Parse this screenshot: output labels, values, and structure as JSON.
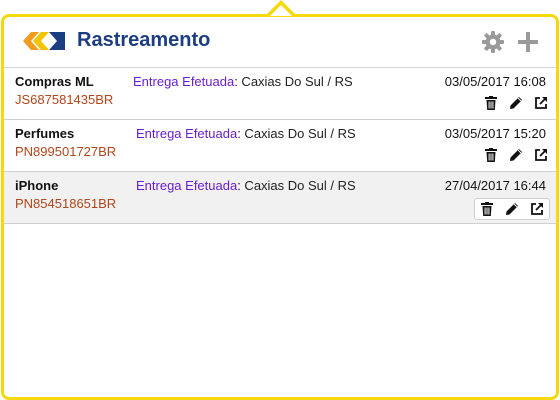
{
  "header": {
    "title": "Rastreamento",
    "settings_icon": "gear-icon",
    "add_icon": "plus-icon"
  },
  "colors": {
    "border": "#f5d90a",
    "title": "#1c3d82",
    "status_label": "#6a1ecf",
    "tracking_code": "#b0461a",
    "logo_orange": "#f29c1f",
    "logo_blue": "#1c3d82"
  },
  "items": [
    {
      "name": "Compras ML",
      "code": "JS687581435BR",
      "status_label": "Entrega Efetuada",
      "location": ": Caxias Do Sul / RS",
      "datetime": "03/05/2017 16:08",
      "actions": [
        "trash-icon",
        "pencil-icon",
        "external-link-icon"
      ]
    },
    {
      "name": "Perfumes",
      "code": "PN899501727BR",
      "status_label": "Entrega Efetuada",
      "location": ": Caxias Do Sul / RS",
      "datetime": "03/05/2017 15:20",
      "actions": [
        "trash-icon",
        "pencil-icon",
        "external-link-icon"
      ]
    },
    {
      "name": "iPhone",
      "code": "PN854518651BR",
      "status_label": "Entrega Efetuada",
      "location": ": Caxias Do Sul / RS",
      "datetime": "27/04/2017 16:44",
      "actions": [
        "trash-icon",
        "pencil-icon",
        "external-link-icon"
      ]
    }
  ]
}
